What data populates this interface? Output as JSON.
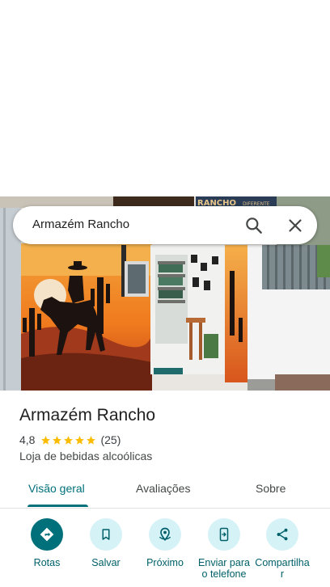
{
  "search": {
    "query": "Armazém Rancho",
    "search_icon": "search-icon",
    "close_icon": "close-icon"
  },
  "place": {
    "name": "Armazém Rancho",
    "rating": "4,8",
    "stars": 5,
    "review_count": "(25)",
    "category": "Loja de bebidas alcoólicas"
  },
  "photo": {
    "sign_text": "RANCHO",
    "sign_small": "DIFERENTE"
  },
  "tabs": [
    {
      "label": "Visão geral",
      "active": true
    },
    {
      "label": "Avaliações",
      "active": false
    },
    {
      "label": "Sobre",
      "active": false
    }
  ],
  "actions": [
    {
      "label": "Rotas",
      "icon": "directions-icon"
    },
    {
      "label": "Salvar",
      "icon": "bookmark-icon"
    },
    {
      "label": "Próximo",
      "icon": "nearby-icon"
    },
    {
      "label": "Enviar para o telefone",
      "icon": "send-to-phone-icon"
    },
    {
      "label": "Compartilhar",
      "icon": "share-icon"
    }
  ],
  "colors": {
    "accent": "#00707a",
    "action_bg": "#d5f2f6",
    "star": "#fbbc04"
  }
}
